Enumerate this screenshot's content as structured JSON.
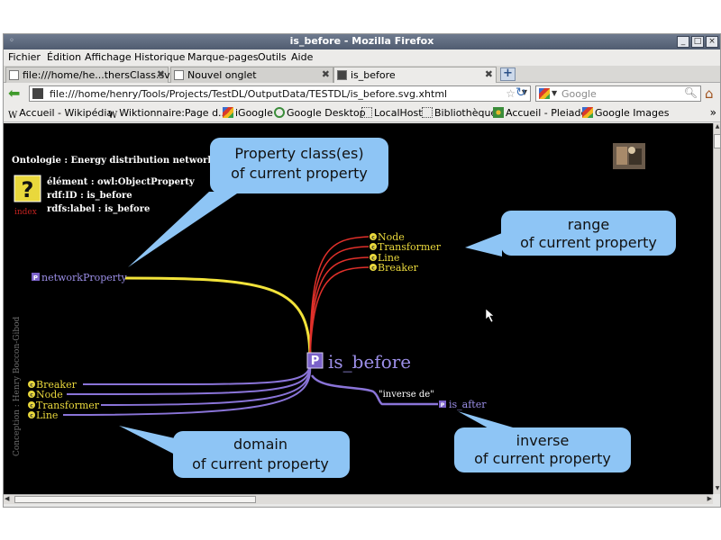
{
  "window": {
    "title": "is_before - Mozilla Firefox",
    "buttons": {
      "minimize": "_",
      "maximize": "□",
      "close": "×"
    }
  },
  "menu": {
    "items": [
      "Fichier",
      "Édition",
      "Affichage",
      "Historique",
      "Marque-pages",
      "Outils",
      "Aide"
    ]
  },
  "tabs": [
    {
      "label": "file:///home/he...thersClass.svg",
      "active": false
    },
    {
      "label": "Nouvel onglet",
      "active": false
    },
    {
      "label": "is_before",
      "active": true
    }
  ],
  "navbar": {
    "url": "file:///home/henry/Tools/Projects/TestDL/OutputData/TESTDL/is_before.svg.xhtml",
    "search_placeholder": "Google"
  },
  "bookmarks": [
    {
      "label": "Accueil - Wikipédia",
      "icon": "wikipedia-icon"
    },
    {
      "label": "Wiktionnaire:Page d...",
      "icon": "wiktionary-icon"
    },
    {
      "label": "iGoogle",
      "icon": "google-icon"
    },
    {
      "label": "Google Desktop",
      "icon": "google-desktop-icon"
    },
    {
      "label": "LocalHost",
      "icon": "page-icon"
    },
    {
      "label": "Bibliothèque",
      "icon": "page-icon"
    },
    {
      "label": "Accueil - Pleiade",
      "icon": "pleiade-icon"
    },
    {
      "label": "Google Images",
      "icon": "google-icon"
    }
  ],
  "ontology": {
    "title": "Ontologie : Energy distribution network",
    "element": "élément : owl:ObjectProperty",
    "rdf_id": "rdf:ID : is_before",
    "rdfs_label": "rdfs:label : is_before",
    "index_label": "index",
    "help_glyph": "?",
    "center_property": "is_before",
    "center_badge": "P",
    "parent_property": "networkProperty",
    "range_classes": [
      "Node",
      "Transformer",
      "Line",
      "Breaker"
    ],
    "domain_classes": [
      "Breaker",
      "Node",
      "Transformer",
      "Line"
    ],
    "inverse_relation": "\"inverse de\"",
    "inverse_property": "is_after",
    "class_badge": "c",
    "property_badge": "P",
    "credit": "Conception : Henry Boccon-Gibod"
  },
  "callouts": {
    "property_class": [
      "Property class(es)",
      "of current property"
    ],
    "range": [
      "range",
      "of current property"
    ],
    "domain": [
      "domain",
      "of current property"
    ],
    "inverse": [
      "inverse",
      "of current property"
    ]
  },
  "colors": {
    "background": "#000000",
    "property_purple": "#7b62c9",
    "class_yellow": "#e9d83c",
    "range_red": "#e0302a",
    "parent_yellow": "#f2e33a",
    "callout_fill": "#8ec5f5",
    "index_red": "#b22222"
  }
}
